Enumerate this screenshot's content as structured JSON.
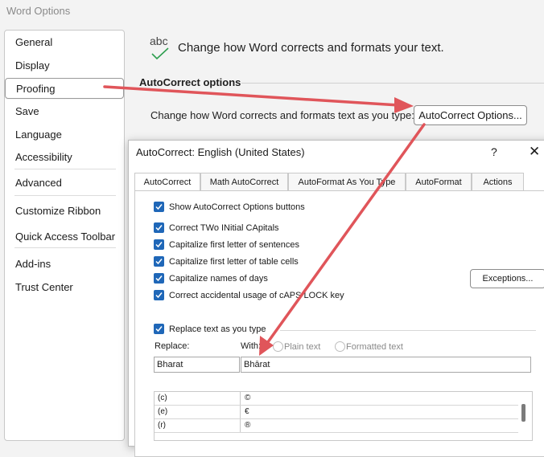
{
  "window": {
    "title": "Word Options"
  },
  "sidebar": {
    "items": [
      {
        "label": "General"
      },
      {
        "label": "Display"
      },
      {
        "label": "Proofing"
      },
      {
        "label": "Save"
      },
      {
        "label": "Language"
      },
      {
        "label": "Accessibility"
      },
      {
        "label": "Advanced"
      },
      {
        "label": "Customize Ribbon"
      },
      {
        "label": "Quick Access Toolbar"
      },
      {
        "label": "Add-ins"
      },
      {
        "label": "Trust Center"
      }
    ],
    "selected": "Proofing"
  },
  "header": {
    "icon_text": "abc",
    "text": "Change how Word corrects and formats your text."
  },
  "autocorrect_section": {
    "title": "AutoCorrect options",
    "description": "Change how Word corrects and formats text as you type:",
    "button_label": "AutoCorrect Options..."
  },
  "dialog": {
    "title": "AutoCorrect: English (United States)",
    "help": "?",
    "close": "✕",
    "tabs": [
      {
        "label": "AutoCorrect"
      },
      {
        "label": "Math AutoCorrect"
      },
      {
        "label": "AutoFormat As You Type"
      },
      {
        "label": "AutoFormat"
      },
      {
        "label": "Actions"
      }
    ],
    "active_tab": "AutoCorrect",
    "options": [
      {
        "label": "Show AutoCorrect Options buttons",
        "checked": true
      },
      {
        "label": "Correct TWo INitial CApitals",
        "checked": true
      },
      {
        "label": "Capitalize first letter of sentences",
        "checked": true
      },
      {
        "label": "Capitalize first letter of table cells",
        "checked": true
      },
      {
        "label": "Capitalize names of days",
        "checked": true
      },
      {
        "label": "Correct accidental usage of cAPS LOCK key",
        "checked": true
      }
    ],
    "exceptions_label": "Exceptions...",
    "replace_text": {
      "label": "Replace text as you type",
      "checked": true
    },
    "replace_label": "Replace:",
    "with_label": "With:",
    "plain_text_label": "Plain text",
    "formatted_text_label": "Formatted text",
    "replace_value": "Bharat",
    "with_value": "Bhārat",
    "entries": [
      {
        "key": "(c)",
        "value": "©"
      },
      {
        "key": "(e)",
        "value": "€"
      },
      {
        "key": "(r)",
        "value": "®"
      }
    ]
  },
  "colors": {
    "accent": "#1f67b8",
    "arrow": "#e0555a"
  }
}
